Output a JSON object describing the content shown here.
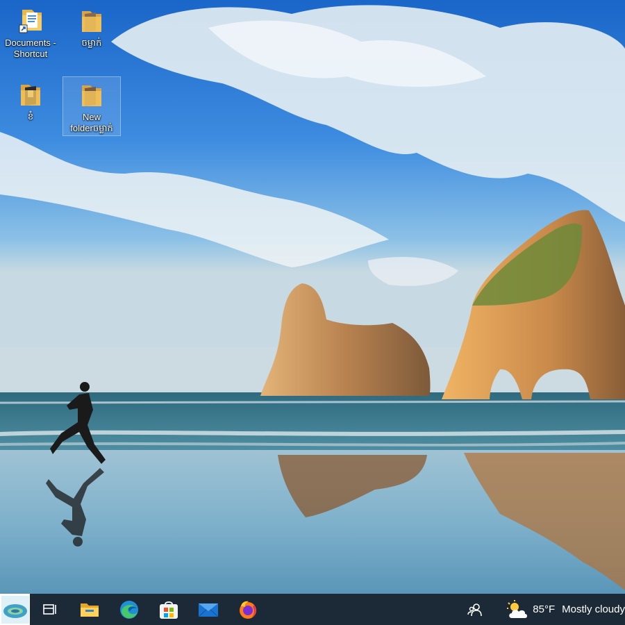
{
  "desktop": {
    "icons": [
      {
        "label_1": "Documents -",
        "label_2": "Shortcut",
        "icon": "document-shortcut-icon"
      },
      {
        "label_1": "ចម្លាក់",
        "icon": "folder-icon"
      },
      {
        "label_1": "ខំ",
        "icon": "folder-icon"
      },
      {
        "label_1": "New",
        "label_2": "folderចម្លាក់",
        "icon": "folder-icon"
      }
    ]
  },
  "taskbar": {
    "apps": [
      "start-icon",
      "task-view-icon",
      "file-explorer-icon",
      "edge-icon",
      "store-icon",
      "mail-icon",
      "firefox-icon"
    ],
    "tray": {
      "people_icon": "people-icon",
      "weather_icon": "partly-cloudy-icon",
      "temperature": "85°F",
      "condition": "Mostly cloudy"
    }
  },
  "colors": {
    "taskbar": "#1c2a38",
    "sky_top": "#1a66c9",
    "sea": "#3d7d8f"
  }
}
